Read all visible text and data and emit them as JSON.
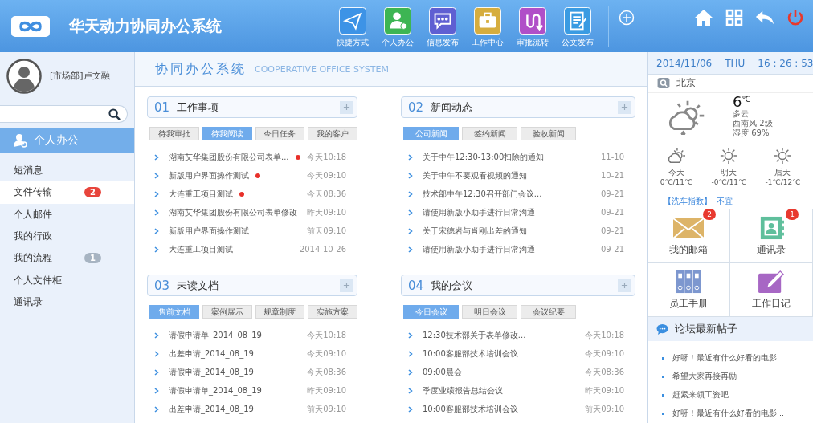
{
  "header": {
    "title": "华天动力协同办公系统",
    "nav": [
      {
        "kind": "send",
        "label": "快捷方式"
      },
      {
        "kind": "person",
        "label": "个人办公"
      },
      {
        "kind": "chat",
        "label": "信息发布"
      },
      {
        "kind": "case",
        "label": "工作中心"
      },
      {
        "kind": "flow",
        "label": "审批流转"
      },
      {
        "kind": "doc",
        "label": "公文发布"
      }
    ]
  },
  "sidebar": {
    "user": "[市场部]卢文融",
    "section": "个人办公",
    "items": [
      {
        "label": "短消息",
        "selected": false
      },
      {
        "label": "文件传输",
        "selected": true,
        "badge": "2",
        "color": "#e8453c"
      },
      {
        "label": "个人邮件",
        "selected": false
      },
      {
        "label": "我的行政",
        "selected": false
      },
      {
        "label": "我的流程",
        "selected": false,
        "badge": "1",
        "color": "#a7b4c2"
      },
      {
        "label": "个人文件柜",
        "selected": false
      },
      {
        "label": "通讯录",
        "selected": false
      }
    ]
  },
  "main": {
    "title": "协同办公系统",
    "subtitle": "COOPERATIVE OFFICE SYSTEM",
    "panels": [
      {
        "num": "01",
        "title": "工作事项",
        "tabs": [
          {
            "label": "待我审批",
            "selected": false
          },
          {
            "label": "待我阅读",
            "selected": true
          },
          {
            "label": "今日任务",
            "selected": false
          },
          {
            "label": "我的客户",
            "selected": false
          }
        ],
        "rows": [
          {
            "text": "湖南艾华集团股份有限公司表单...",
            "date": "今天10:18",
            "unread": true
          },
          {
            "text": "新版用户界面操作测试",
            "date": "今天09:10",
            "unread": true
          },
          {
            "text": "大连重工项目测试",
            "date": "今天08:36",
            "unread": true
          },
          {
            "text": "湖南艾华集团股份有限公司表单修改",
            "date": "昨天09:10",
            "unread": false
          },
          {
            "text": "新版用户界面操作测试",
            "date": "前天09:10",
            "unread": false
          },
          {
            "text": "大连重工项目测试",
            "date": "2014-10-26",
            "unread": false
          }
        ]
      },
      {
        "num": "02",
        "title": "新闻动态",
        "tabs": [
          {
            "label": "公司新闻",
            "selected": true
          },
          {
            "label": "签约新闻",
            "selected": false
          },
          {
            "label": "验收新闻",
            "selected": false
          }
        ],
        "rows": [
          {
            "text": "关于中午12:30-13:00扫除的通知",
            "date": "11-10",
            "unread": false
          },
          {
            "text": "关于中午不要观看视频的通知",
            "date": "10-21",
            "unread": false
          },
          {
            "text": "技术部中午12:30召开部门会议...",
            "date": "09-21",
            "unread": false
          },
          {
            "text": "请使用新版小助手进行日常沟通",
            "date": "09-21",
            "unread": false
          },
          {
            "text": "关于宋德岩与肖刚出差的通知",
            "date": "09-21",
            "unread": false
          },
          {
            "text": "请使用新版小助手进行日常沟通",
            "date": "09-21",
            "unread": false
          }
        ]
      },
      {
        "num": "03",
        "title": "未读文档",
        "tabs": [
          {
            "label": "售前文档",
            "selected": true
          },
          {
            "label": "案例展示",
            "selected": false
          },
          {
            "label": "规章制度",
            "selected": false
          },
          {
            "label": "实施方案",
            "selected": false
          }
        ],
        "rows": [
          {
            "text": "请假申请单_2014_08_19",
            "date": "今天10:18",
            "unread": false
          },
          {
            "text": "出差申请_2014_08_19",
            "date": "今天09:10",
            "unread": false
          },
          {
            "text": "请假申请_2014_08_19",
            "date": "今天08:36",
            "unread": false
          },
          {
            "text": "请假申请单_2014_08_19",
            "date": "昨天09:10",
            "unread": false
          },
          {
            "text": "出差申请_2014_08_19",
            "date": "前天09:10",
            "unread": false
          }
        ]
      },
      {
        "num": "04",
        "title": "我的会议",
        "tabs": [
          {
            "label": "今日会议",
            "selected": true
          },
          {
            "label": "明日会议",
            "selected": false
          },
          {
            "label": "会议纪要",
            "selected": false
          }
        ],
        "rows": [
          {
            "text": "12:30技术部关于表单修改...",
            "date": "今天10:18",
            "unread": false
          },
          {
            "text": "10:00客服部技术培训会议",
            "date": "今天09:10",
            "unread": false
          },
          {
            "text": "09:00晨会",
            "date": "今天08:36",
            "unread": false
          },
          {
            "text": "季度业绩报告总结会议",
            "date": "昨天09:10",
            "unread": false
          },
          {
            "text": "10:00客服部技术培训会议",
            "date": "前天09:10",
            "unread": false
          }
        ]
      }
    ]
  },
  "right": {
    "date": "2014/11/06",
    "weekday": "THU",
    "time": "16 : 26 : 53",
    "weather": {
      "city": "北京",
      "temp": "6",
      "unit": "℃",
      "desc": "多云",
      "wind": "西南风 2级",
      "humidity": "湿度 69%",
      "forecast": [
        {
          "kind": "cloudy",
          "day": "今天",
          "range": "0℃/11℃"
        },
        {
          "kind": "sunny",
          "day": "明天",
          "range": "-0℃/11℃"
        },
        {
          "kind": "sunny",
          "day": "后天",
          "range": "-1℃/12℃"
        }
      ]
    },
    "carwash": {
      "label": "【洗车指数】",
      "value": "不宜"
    },
    "shortcuts": [
      {
        "kind": "mail",
        "label": "我的邮箱",
        "badge": "2"
      },
      {
        "kind": "contacts",
        "label": "通讯录",
        "badge": "1"
      },
      {
        "kind": "binders",
        "label": "员工手册"
      },
      {
        "kind": "diary",
        "label": "工作日记"
      }
    ],
    "forum": {
      "title": "论坛最新帖子",
      "posts": [
        "好呀！最近有什么好看的电影...",
        "希望大家再接再励",
        "赶紧来领工资吧",
        "好呀！最近有什么好看的电影..."
      ]
    }
  }
}
